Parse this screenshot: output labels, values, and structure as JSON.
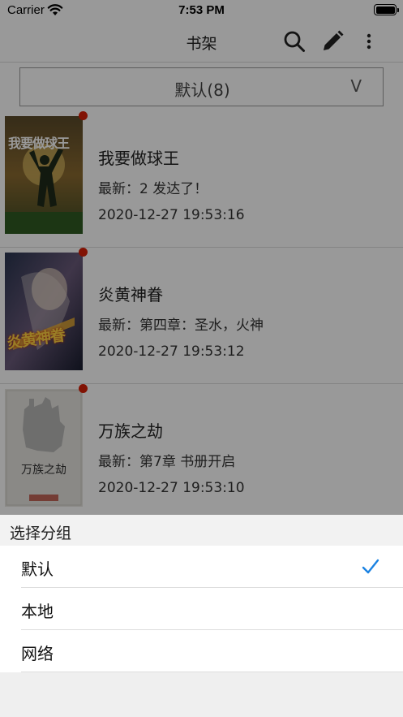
{
  "status_bar": {
    "carrier": "Carrier",
    "time": "7:53 PM"
  },
  "nav": {
    "title": "书架",
    "icons": [
      "search-icon",
      "edit-pencil-icon",
      "more-vertical-icon"
    ]
  },
  "group_selector": {
    "label": "默认(8)",
    "arrow": "V"
  },
  "books": [
    {
      "title": "我要做球王",
      "latest": "最新：2 发达了！",
      "time": "2020-12-27 19:53:16",
      "cover_text": "我要做球王",
      "unread": true
    },
    {
      "title": "炎黄神眷",
      "latest": "最新：第四章：圣水，火神",
      "time": "2020-12-27 19:53:12",
      "cover_text": "炎黄神眷",
      "unread": true
    },
    {
      "title": "万族之劫",
      "latest": "最新：第7章 书册开启",
      "time": "2020-12-27 19:53:10",
      "cover_text": "万族之劫",
      "unread": true
    }
  ],
  "sheet": {
    "title": "选择分组",
    "options": [
      {
        "label": "默认",
        "selected": true
      },
      {
        "label": "本地",
        "selected": false
      },
      {
        "label": "网络",
        "selected": false
      }
    ]
  },
  "colors": {
    "accent": "#1a82e2",
    "unread_dot": "#d81e06",
    "overlay": "rgba(0,0,0,0.40)"
  }
}
